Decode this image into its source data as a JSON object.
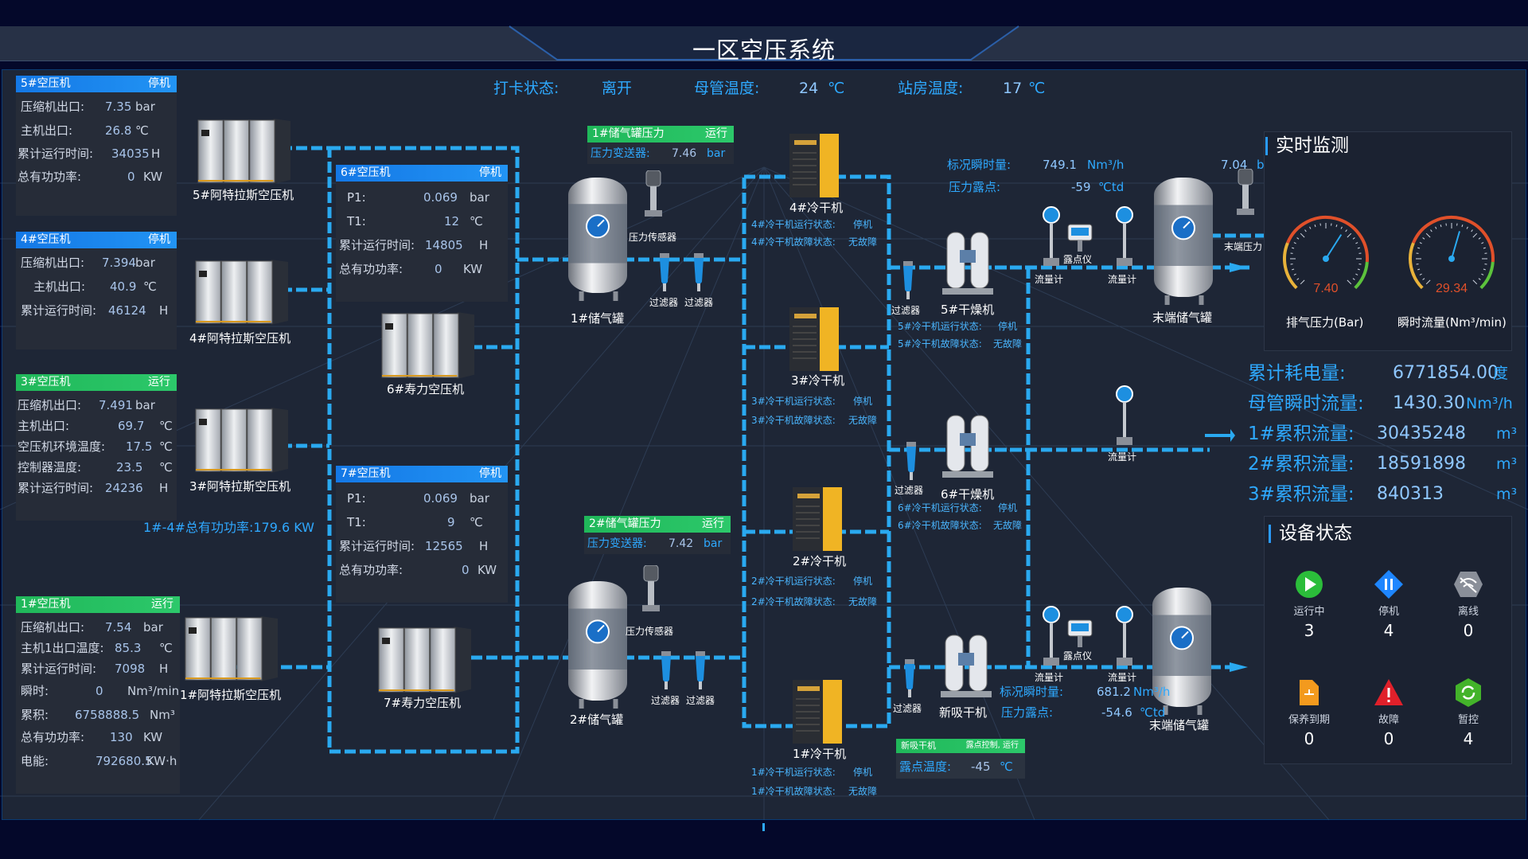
{
  "header": {
    "title": "一区空压系统"
  },
  "status_bar": {
    "checkin_label": "打卡状态:",
    "checkin_value": "离开",
    "main_temp_label": "母管温度:",
    "main_temp_value": "24",
    "main_temp_unit": "℃",
    "room_temp_label": "站房温度:",
    "room_temp_value": "17",
    "room_temp_unit": "℃"
  },
  "compressors": {
    "c5": {
      "title": "5#空压机",
      "status": "停机",
      "rows": [
        {
          "label": "压缩机出口:",
          "value": "7.35",
          "unit": "bar"
        },
        {
          "label": "主机出口:",
          "value": "26.8",
          "unit": "℃"
        },
        {
          "label": "累计运行时间:",
          "value": "34035",
          "unit": "H"
        },
        {
          "label": "总有功功率:",
          "value": "0",
          "unit": "KW"
        }
      ],
      "machine": "5#阿特拉斯空压机"
    },
    "c4": {
      "title": "4#空压机",
      "status": "停机",
      "rows": [
        {
          "label": "压缩机出口:",
          "value": "7.394",
          "unit": "bar"
        },
        {
          "label": "主机出口:",
          "value": "40.9",
          "unit": "℃"
        },
        {
          "label": "累计运行时间:",
          "value": "46124",
          "unit": "H"
        }
      ],
      "machine": "4#阿特拉斯空压机"
    },
    "c3": {
      "title": "3#空压机",
      "status": "运行",
      "rows": [
        {
          "label": "压缩机出口:",
          "value": "7.491",
          "unit": "bar"
        },
        {
          "label": "主机出口:",
          "value": "69.7",
          "unit": "℃"
        },
        {
          "label": "空压机环境温度:",
          "value": "17.5",
          "unit": "℃"
        },
        {
          "label": "控制器温度:",
          "value": "23.5",
          "unit": "℃"
        },
        {
          "label": "累计运行时间:",
          "value": "24236",
          "unit": "H"
        }
      ],
      "machine": "3#阿特拉斯空压机"
    },
    "c1": {
      "title": "1#空压机",
      "status": "运行",
      "rows": [
        {
          "label": "压缩机出口:",
          "value": "7.54",
          "unit": "bar"
        },
        {
          "label": "主机1出口温度:",
          "value": "85.3",
          "unit": "℃"
        },
        {
          "label": "累计运行时间:",
          "value": "7098",
          "unit": "H"
        },
        {
          "label": "瞬时:",
          "value": "0",
          "unit": "Nm³/min"
        },
        {
          "label": "累积:",
          "value": "6758888.5",
          "unit": "Nm³"
        },
        {
          "label": "总有功功率:",
          "value": "130",
          "unit": "KW"
        },
        {
          "label": "电能:",
          "value": "792680.5",
          "unit": "KW·h"
        }
      ],
      "machine": "1#阿特拉斯空压机"
    },
    "c6": {
      "title": "6#空压机",
      "status": "停机",
      "rows": [
        {
          "label": "P1:",
          "value": "0.069",
          "unit": "bar"
        },
        {
          "label": "T1:",
          "value": "12",
          "unit": "℃"
        },
        {
          "label": "累计运行时间:",
          "value": "14805",
          "unit": "H"
        },
        {
          "label": "总有功功率:",
          "value": "0",
          "unit": "KW"
        }
      ],
      "machine": "6#寿力空压机"
    },
    "c7": {
      "title": "7#空压机",
      "status": "停机",
      "rows": [
        {
          "label": "P1:",
          "value": "0.069",
          "unit": "bar"
        },
        {
          "label": "T1:",
          "value": "9",
          "unit": "℃"
        },
        {
          "label": "累计运行时间:",
          "value": "12565",
          "unit": "H"
        },
        {
          "label": "总有功功率:",
          "value": "0",
          "unit": "KW"
        }
      ],
      "machine": "7#寿力空压机"
    }
  },
  "total_power": "1#-4#总有功功率:179.6 KW",
  "tanks": {
    "t1": {
      "panel_title": "1#储气罐压力",
      "status": "运行",
      "label": "压力变送器:",
      "value": "7.46",
      "unit": "bar",
      "name": "1#储气罐"
    },
    "t2": {
      "panel_title": "2#储气罐压力",
      "status": "运行",
      "label": "压力变送器:",
      "value": "7.42",
      "unit": "bar",
      "name": "2#储气罐"
    }
  },
  "components": {
    "pressure_sensor": "压力传感器",
    "filter": "过滤器",
    "flowmeter": "流量计",
    "dewpoint_meter": "露点仪",
    "end_tank": "末端储气罐",
    "end_pressure": "末端压力"
  },
  "coolers": [
    {
      "name": "4#冷干机",
      "run_label": "4#冷干机运行状态:",
      "run": "停机",
      "fault_label": "4#冷干机故障状态:",
      "fault": "无故障"
    },
    {
      "name": "3#冷干机",
      "run_label": "3#冷干机运行状态:",
      "run": "停机",
      "fault_label": "3#冷干机故障状态:",
      "fault": "无故障"
    },
    {
      "name": "2#冷干机",
      "run_label": "2#冷干机运行状态:",
      "run": "停机",
      "fault_label": "2#冷干机故障状态:",
      "fault": "无故障"
    },
    {
      "name": "1#冷干机",
      "run_label": "1#冷干机运行状态:",
      "run": "停机",
      "fault_label": "1#冷干机故障状态:",
      "fault": "无故障"
    }
  ],
  "dryers": [
    {
      "name": "5#干燥机",
      "run_label": "5#冷干机运行状态:",
      "run": "停机",
      "fault_label": "5#冷干机故障状态:",
      "fault": "无故障"
    },
    {
      "name": "6#干燥机",
      "run_label": "6#冷干机运行状态:",
      "run": "停机",
      "fault_label": "6#冷干机故障状态:",
      "fault": "无故障"
    },
    {
      "name": "新吸干机"
    }
  ],
  "new_dryer_panel": {
    "title": "新吸干机",
    "status": "露点控制, 运行",
    "label": "露点温度:",
    "value": "-45",
    "unit": "℃"
  },
  "line_top": {
    "flow_label": "标况瞬时量:",
    "flow_value": "749.1",
    "flow_unit": "Nm³/h",
    "dew_label": "压力露点:",
    "dew_value": "-59",
    "dew_unit": "℃td",
    "end_value": "7.04",
    "end_unit": "bar"
  },
  "line_bottom": {
    "flow_label": "标况瞬时量:",
    "flow_value": "681.2",
    "flow_unit": "Nm³/h",
    "dew_label": "压力露点:",
    "dew_value": "-54.6",
    "dew_unit": "℃td"
  },
  "realtime": {
    "title": "实时监测",
    "gauges": [
      {
        "label": "排气压力(Bar)",
        "value": "7.40",
        "fraction": 0.62
      },
      {
        "label": "瞬时流量(Nm³/min)",
        "value": "29.34",
        "fraction": 0.56
      }
    ]
  },
  "summary": [
    {
      "label": "累计耗电量:",
      "value": "6771854.00",
      "unit": "度"
    },
    {
      "label": "母管瞬时流量:",
      "value": "1430.30",
      "unit": "Nm³/h"
    },
    {
      "label": "1#累积流量:",
      "value": "30435248",
      "unit": "m³"
    },
    {
      "label": "2#累积流量:",
      "value": "18591898",
      "unit": "m³"
    },
    {
      "label": "3#累积流量:",
      "value": "840313",
      "unit": "m³"
    }
  ],
  "device_status": {
    "title": "设备状态",
    "items": [
      {
        "label": "运行中",
        "value": "3",
        "icon": "play-icon",
        "color": "#2bbd3a"
      },
      {
        "label": "停机",
        "value": "4",
        "icon": "pause-icon",
        "color": "#1e86ff"
      },
      {
        "label": "离线",
        "value": "0",
        "icon": "wifi-off-icon",
        "color": "#8a8f99"
      },
      {
        "label": "保养到期",
        "value": "0",
        "icon": "document-icon",
        "color": "#f39a1e"
      },
      {
        "label": "故障",
        "value": "0",
        "icon": "warning-icon",
        "color": "#e0202a"
      },
      {
        "label": "暂控",
        "value": "4",
        "icon": "refresh-icon",
        "color": "#43b32a"
      }
    ]
  }
}
